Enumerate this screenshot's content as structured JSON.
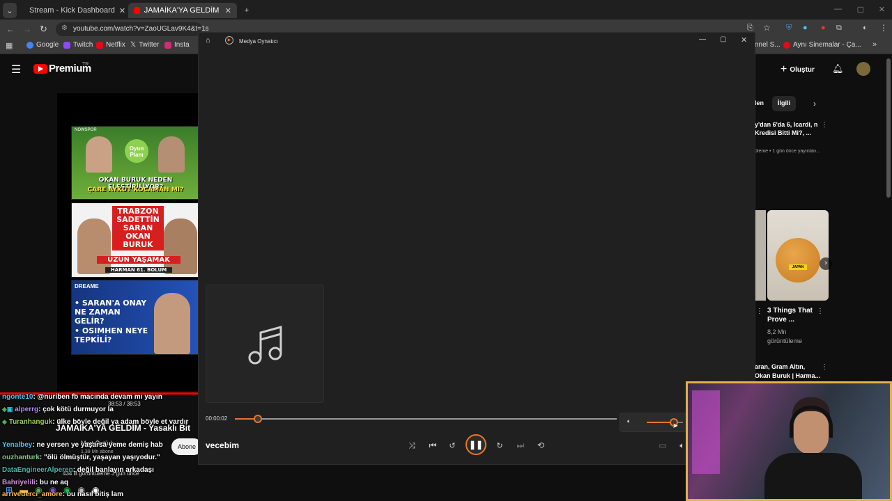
{
  "browser": {
    "tabs": [
      {
        "label": "Stream - Kick Dashboard",
        "active": false
      },
      {
        "label": "JAMAİKA'YA GELDİM - Yasaklı E",
        "active": true
      }
    ],
    "url": "youtube.com/watch?v=ZaoUGLav9K4&t=1s",
    "bookmarks": [
      "Google",
      "Twitch",
      "Netflix",
      "Twitter",
      "Insta",
      "nnel S...",
      "Aynı Sinemalar - Ça..."
    ]
  },
  "youtube": {
    "logo": "Premium",
    "region": "TR",
    "create_label": "Oluştur",
    "chips": [
      "len",
      "İlgili"
    ],
    "video_title": "JAMAİKA'YA GELDİM - Yasaklı Bit",
    "time": "38:53 / 38:53",
    "channel": "Mert Öztürk",
    "subs": "1,39 Mn abone",
    "subscribe": "Abone",
    "views": "434 B görüntüleme  3 gün önce",
    "thumbs": [
      {
        "line1": "OKAN BURUK NEDEN ELEŞTİRİLİYOR?",
        "line2": "ÇARE AYKUT KOCAMAN MI?",
        "badge": "Oyun Planı"
      },
      {
        "line1": "TRABZON SADETTİN SARAN OKAN BURUK",
        "line2": "UZUN YAŞAMAK",
        "sub": "HARMAN 61. BÖLÜM"
      },
      {
        "brand": "DREAME",
        "line1": "• SARAN'A ONAY NE ZAMAN GELİR?",
        "line2": "• OSIMHEN NEYE TEPKİLİ?"
      }
    ],
    "recs": [
      {
        "title": "y'dan 6'da 6, Icardi, n Kredisi Bitti Mi?, ...",
        "meta": "üleme • 1 gün önce yayınlan..."
      },
      {
        "title": "3 Things That Prove ...",
        "meta": "8,2 Mn görüntüleme"
      },
      {
        "title": "aran, Gram Altın, Okan Buruk | Harma...",
        "meta": ""
      }
    ]
  },
  "chat": [
    {
      "user": "ngonte10",
      "msg": ": @nuriben fb macında devam mı yayın",
      "color": "#4fc3f7"
    },
    {
      "user": "alperrg",
      "msg": ": çok kötü durmuyor la",
      "color": "#b388ff"
    },
    {
      "user": "Turanhanguk",
      "msg": ": ülke böyle değil ya adam böyle et vardır",
      "color": "#9ccc65"
    },
    {
      "user": "Yenalbey",
      "msg": ": ne yersen ye yaşarsa yeme demiş hab",
      "color": "#4fc3f7"
    },
    {
      "user": "ouzhanturk",
      "msg": ": \"ölü ölmüştür, yaşayan yaşıyodur.\"",
      "color": "#81c784"
    },
    {
      "user": "DataEngineerAlperen",
      "msg": ": değil banlayın arkadaşı",
      "color": "#4db6ac"
    },
    {
      "user": "Bahriyelili",
      "msg": ": bu ne aq",
      "color": "#ce93d8"
    },
    {
      "user": "arrivederci_amore",
      "msg": ": bu nasıl bitiş lam",
      "color": "#ffb74d"
    }
  ],
  "player": {
    "title": "Medya Oynatıcı",
    "elapsed": "00:00:02",
    "track": "vecebim",
    "progress": 0.06,
    "volume": 0.75,
    "accent": "#e8762c"
  }
}
